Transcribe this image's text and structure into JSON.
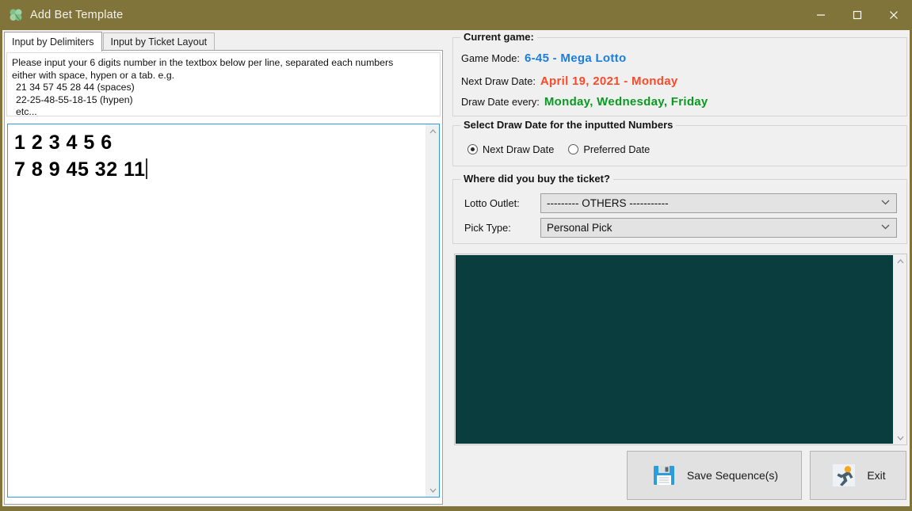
{
  "window": {
    "title": "Add Bet Template",
    "icon": "clover-icon",
    "titlebar_color": "#80743a",
    "controls": {
      "minimize": "minimize-icon",
      "maximize": "maximize-icon",
      "close": "close-icon"
    }
  },
  "tabs": [
    {
      "label": "Input by Delimiters",
      "active": true
    },
    {
      "label": "Input by Ticket Layout",
      "active": false
    }
  ],
  "instructions": {
    "line1": "Please input your 6 digits number in the textbox below per line, separated each numbers",
    "line2": "either with space, hypen or a tab. e.g.",
    "line3": "21 34 57 45 28 44 (spaces)",
    "line4": "22-25-48-55-18-15 (hypen)",
    "line5": "etc..."
  },
  "numbers_input": {
    "value": "1 2 3 4 5 6\n7 8 9 45 32 11",
    "line1": "1 2 3 4 5 6",
    "line2": "7 8 9 45 32 11",
    "focused": true
  },
  "current_game": {
    "title": "Current game:",
    "rows": [
      {
        "label": "Game Mode:",
        "value": "6-45 - Mega Lotto",
        "color": "#1a7ee0"
      },
      {
        "label": "Next Draw Date:",
        "value": "April 19, 2021 - Monday",
        "color": "#fa4a2a"
      },
      {
        "label": "Draw Date every:",
        "value": "Monday, Wednesday, Friday",
        "color": "#089a21"
      }
    ]
  },
  "select_draw_date": {
    "title": "Select Draw Date for the inputted Numbers",
    "options": [
      {
        "label": "Next Draw Date",
        "checked": true
      },
      {
        "label": "Preferred Date",
        "checked": false
      }
    ]
  },
  "where_bought": {
    "title": "Where did you buy the ticket?",
    "fields": [
      {
        "label": "Lotto Outlet:",
        "value": "--------- OTHERS -----------"
      },
      {
        "label": "Pick Type:",
        "value": "Personal Pick"
      }
    ]
  },
  "results_panel": {
    "color": "#0a3d3d",
    "content": ""
  },
  "actions": [
    {
      "label": "Save Sequence(s)",
      "icon": "floppy-disk-icon"
    },
    {
      "label": "Exit",
      "icon": "running-man-icon"
    }
  ]
}
